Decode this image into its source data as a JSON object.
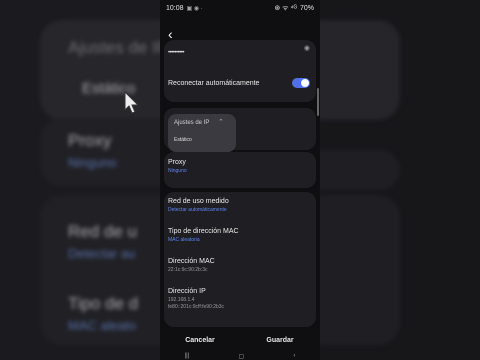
{
  "status_bar": {
    "time": "10:08",
    "mini_icons": "▣ ◉ ·",
    "right_icons": "⊛ ᯤ ⁴ᴳ",
    "battery": "70%"
  },
  "wifi_settings": {
    "password_masked": "••••••••••",
    "auto_reconnect": {
      "label": "Reconectar automáticamente",
      "enabled": true
    },
    "ip_settings": {
      "label": "Ajustes de IP",
      "selected": "Estático"
    },
    "proxy": {
      "label": "Proxy",
      "value": "Ninguno"
    },
    "metered": {
      "label": "Red de uso medido",
      "value": "Detectar automáticamente"
    },
    "mac_type": {
      "label": "Tipo de dirección MAC",
      "value": "MAC aleatoria"
    },
    "mac_address": {
      "label": "Dirección MAC",
      "value": "22:1c:9c:90:2b:3c"
    },
    "ip_address": {
      "label": "Dirección IP",
      "value1": "192.168.1.4",
      "value2": "fe80::201c:9cff:fe90:2b3c"
    }
  },
  "buttons": {
    "cancel": "Cancelar",
    "save": "Guardar"
  },
  "background_overlay": {
    "left": {
      "ip_settings_label": "Ajustes de IP",
      "ip_static_value": "Estático",
      "proxy_label": "Proxy",
      "proxy_value": "Ninguno",
      "metered_label": "Red de u",
      "metered_value": "Detectar au",
      "mac_type_label": "Tipo de d",
      "mac_type_value": "MAC aleato"
    }
  }
}
